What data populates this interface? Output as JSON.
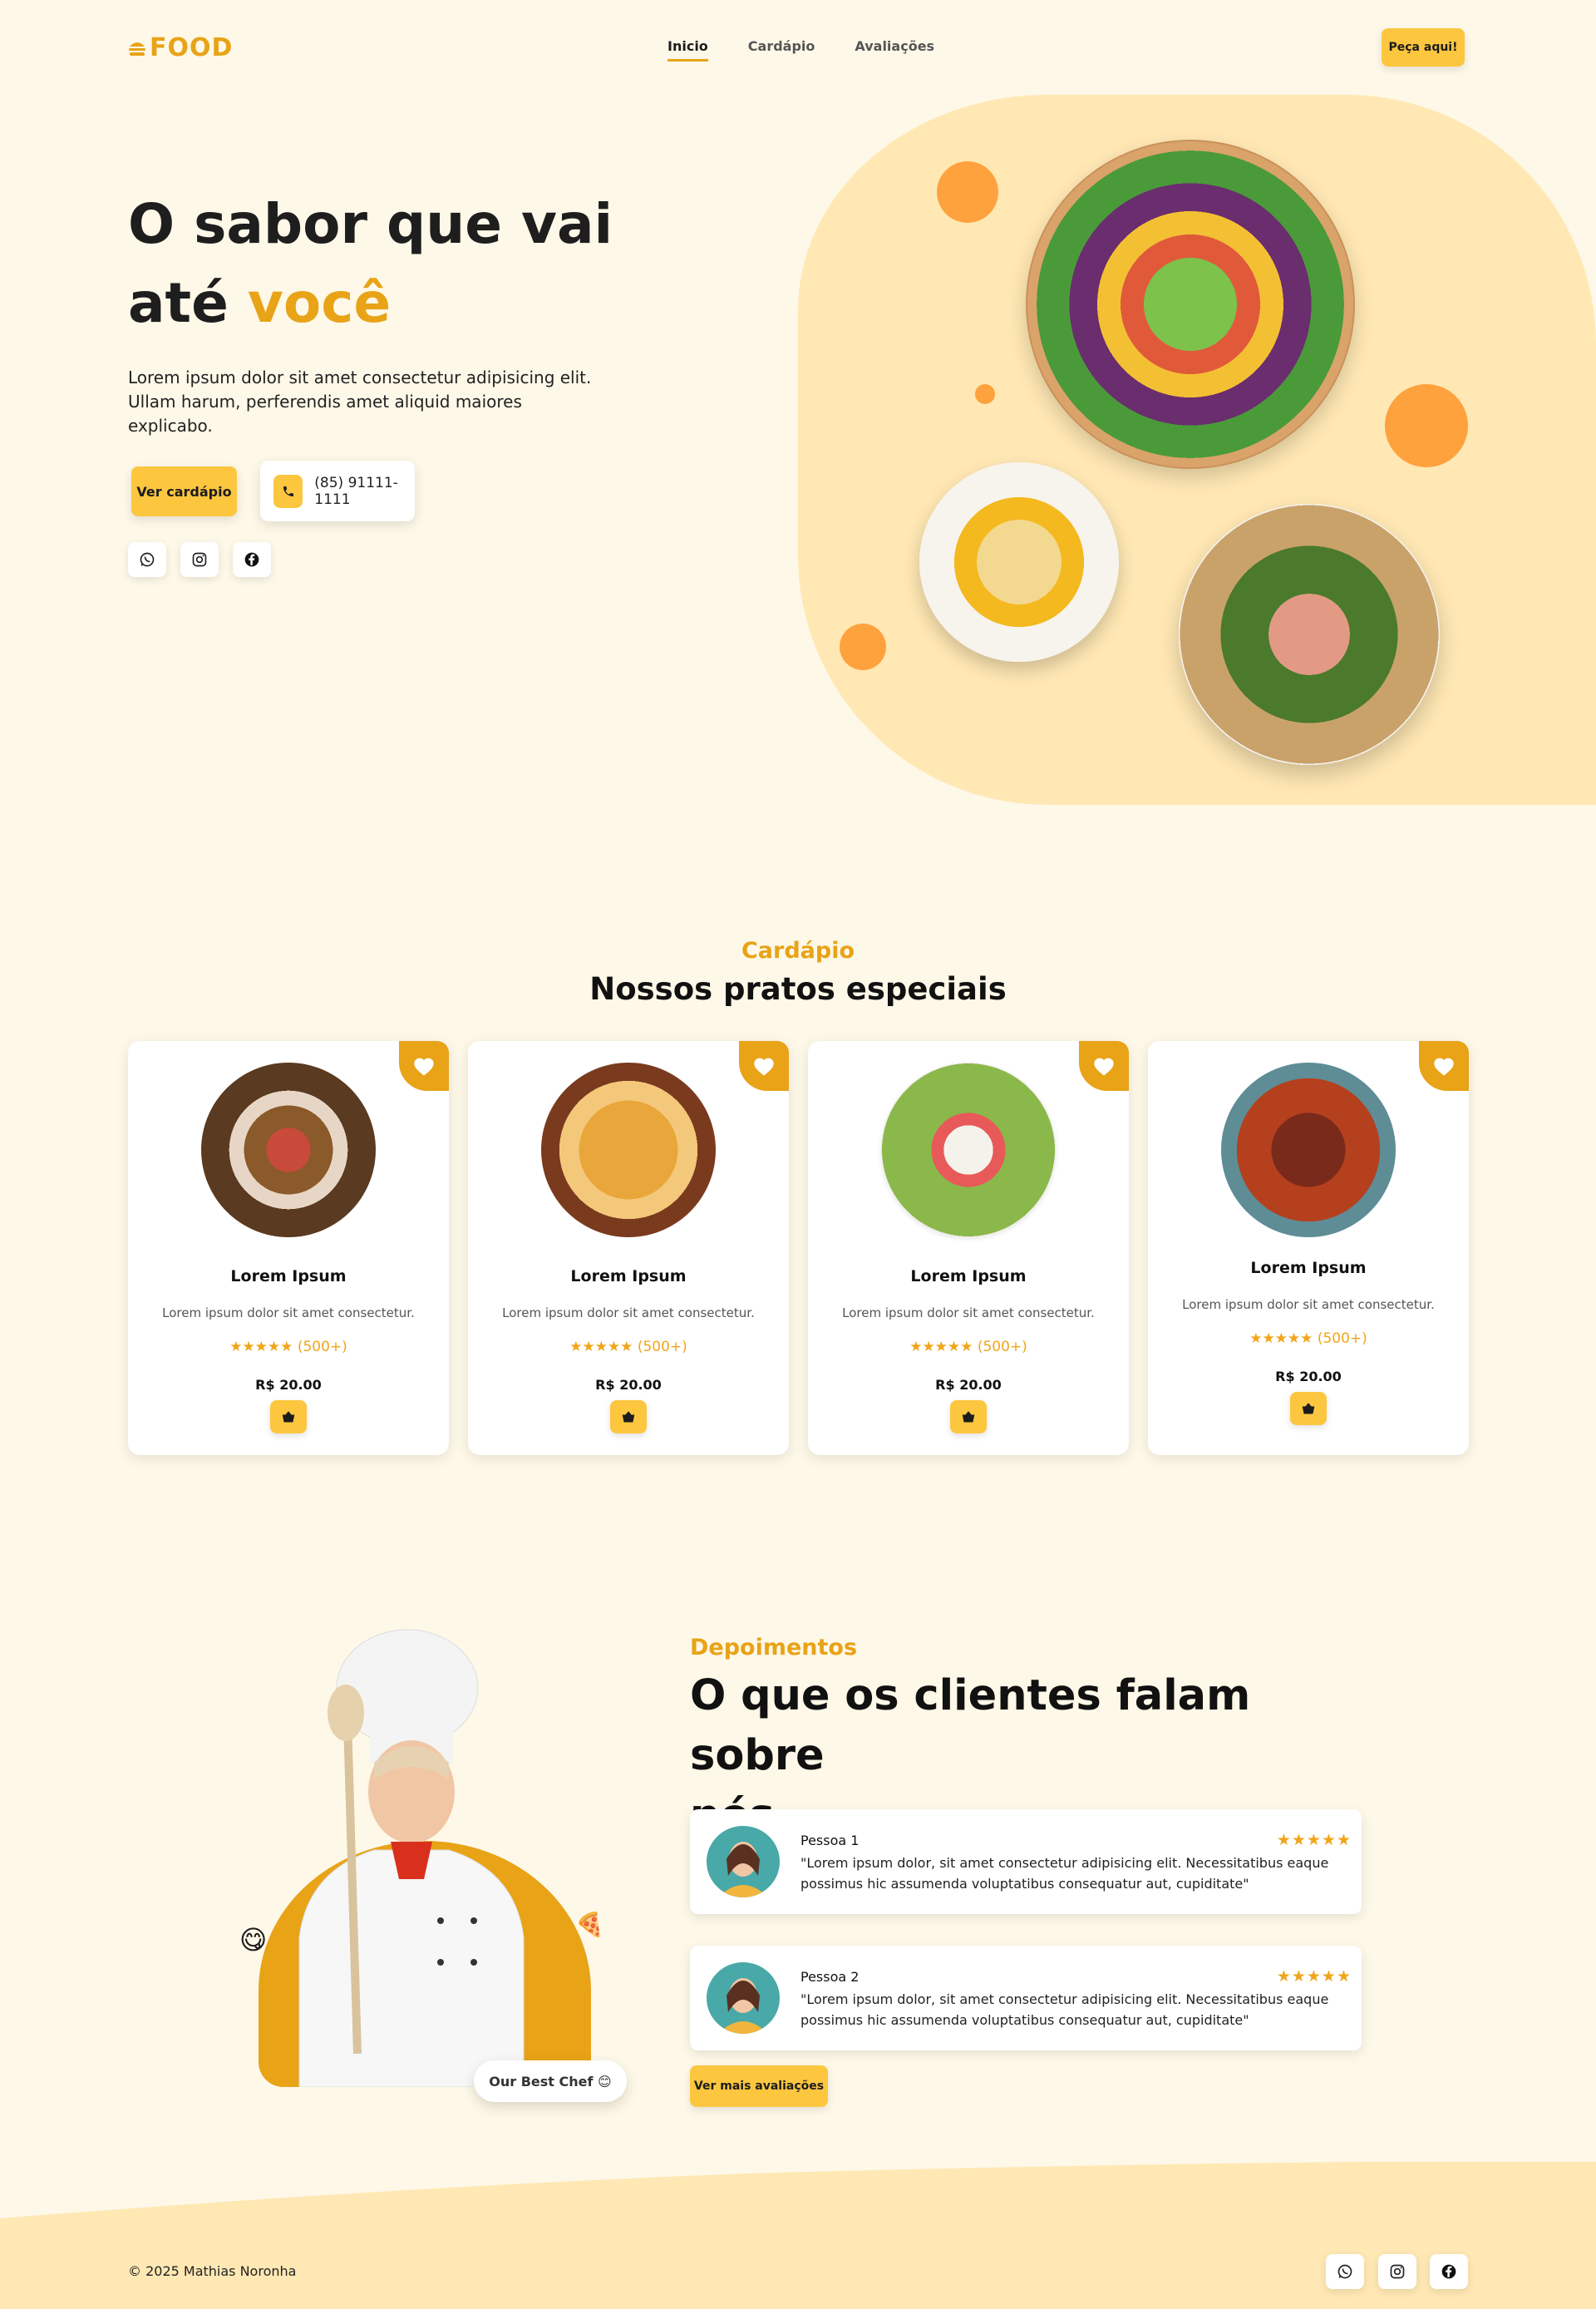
{
  "header": {
    "logo_text": "FOOD",
    "nav": [
      "Inicio",
      "Cardápio",
      "Avaliações"
    ],
    "order_button": "Peça aqui!"
  },
  "hero": {
    "title_line1": "O sabor que vai",
    "title_line2_prefix": "até ",
    "title_highlight": "você",
    "description": "Lorem ipsum dolor sit amet consectetur adipisicing elit. Ullam harum, perferendis amet aliquid maiores explicabo.",
    "menu_button": "Ver cardápio",
    "phone": "(85) 91111-1111",
    "socials": [
      "whatsapp-icon",
      "instagram-icon",
      "facebook-icon"
    ]
  },
  "menu": {
    "kicker": "Cardápio",
    "title": "Nossos pratos especiais",
    "items": [
      {
        "name": "Lorem Ipsum",
        "desc": "Lorem ipsum dolor sit amet consectetur.",
        "stars": "★★★★★",
        "reviews": "(500+)",
        "price": "R$ 20.00"
      },
      {
        "name": "Lorem Ipsum",
        "desc": "Lorem ipsum dolor sit amet consectetur.",
        "stars": "★★★★★",
        "reviews": "(500+)",
        "price": "R$ 20.00"
      },
      {
        "name": "Lorem Ipsum",
        "desc": "Lorem ipsum dolor sit amet consectetur.",
        "stars": "★★★★★",
        "reviews": "(500+)",
        "price": "R$ 20.00"
      },
      {
        "name": "Lorem Ipsum",
        "desc": "Lorem ipsum dolor sit amet consectetur.",
        "stars": "★★★★★",
        "reviews": "(500+)",
        "price": "R$ 20.00"
      }
    ]
  },
  "testimonials": {
    "kicker": "Depoimentos",
    "title_line1": "O que os clientes falam sobre",
    "title_line2": "nós",
    "chef_badge": "Our Best Chef 😊",
    "reviews": [
      {
        "name": "Pessoa 1",
        "stars": "★★★★★",
        "quote": "\"Lorem ipsum dolor, sit amet consectetur adipisicing elit. Necessitatibus eaque possimus hic assumenda voluptatibus consequatur aut, cupiditate\""
      },
      {
        "name": "Pessoa 2",
        "stars": "★★★★★",
        "quote": "\"Lorem ipsum dolor, sit amet consectetur adipisicing elit. Necessitatibus eaque possimus hic assumenda voluptatibus consequatur aut, cupiditate\""
      }
    ],
    "more_button": "Ver mais avaliações"
  },
  "footer": {
    "copyright": "© 2025 Mathias Noronha",
    "socials": [
      "whatsapp-icon",
      "instagram-icon",
      "facebook-icon"
    ]
  },
  "colors": {
    "accent": "#e8a317",
    "button": "#fcc63f",
    "background": "#fef8e8",
    "hero_shape": "#ffe8b4"
  }
}
